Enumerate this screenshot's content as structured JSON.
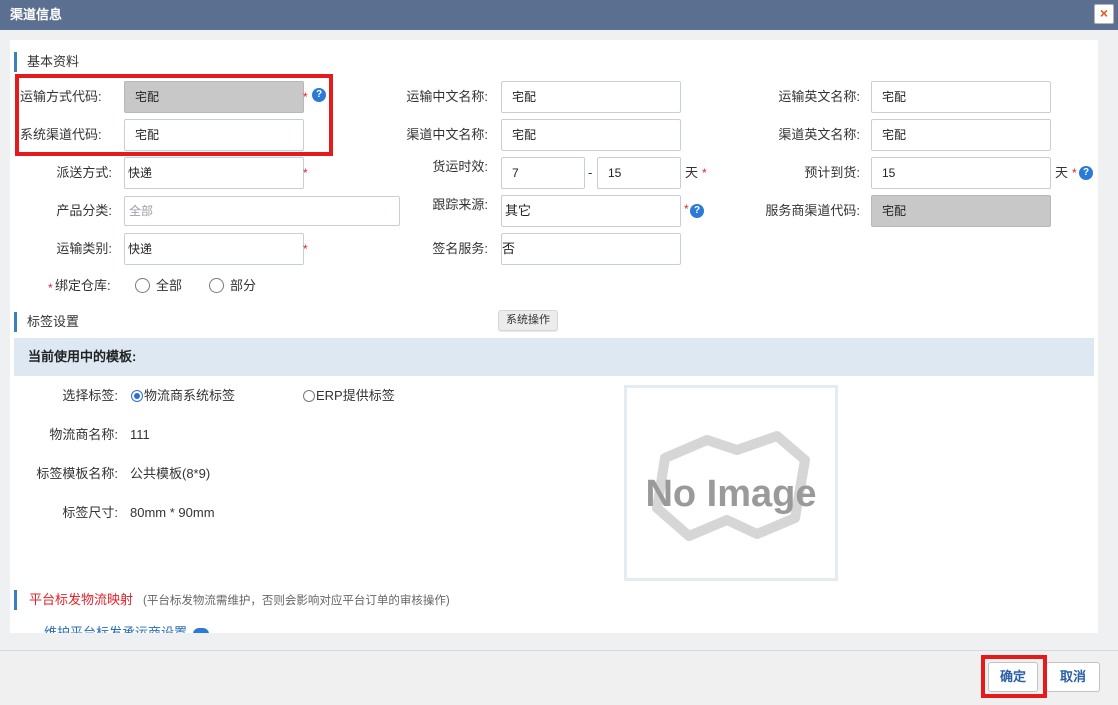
{
  "dialog": {
    "title": "渠道信息",
    "close": "×"
  },
  "basic": {
    "heading": "基本资料",
    "transport_code": {
      "label": "运输方式代码:",
      "value": "宅配"
    },
    "transport_cn": {
      "label": "运输中文名称:",
      "value": "宅配"
    },
    "transport_en": {
      "label": "运输英文名称:",
      "value": "宅配"
    },
    "channel_code": {
      "label": "系统渠道代码:",
      "value": "宅配"
    },
    "channel_cn": {
      "label": "渠道中文名称:",
      "value": "宅配"
    },
    "channel_en": {
      "label": "渠道英文名称:",
      "value": "宅配"
    },
    "delivery": {
      "label": "派送方式:",
      "value": "快递"
    },
    "timeliness": {
      "label": "货运时效:",
      "min": "7",
      "sep": "-",
      "max": "15",
      "unit": "天"
    },
    "arrival": {
      "label": "预计到货:",
      "value": "15",
      "unit": "天"
    },
    "product_cat": {
      "label": "产品分类:",
      "placeholder": "全部"
    },
    "tracking": {
      "label": "跟踪来源:",
      "value": "其它"
    },
    "provider_code": {
      "label": "服务商渠道代码:",
      "value": "宅配"
    },
    "transport_type": {
      "label": "运输类别:",
      "value": "快递"
    },
    "signature": {
      "label": "签名服务:",
      "value": "否"
    },
    "warehouse": {
      "label": "绑定仓库:",
      "option_all": "全部",
      "option_part": "部分"
    },
    "required_mark": "*",
    "help_mark": "?"
  },
  "label_settings": {
    "heading": "标签设置",
    "sys_op_button": "系统操作",
    "current_template": "当前使用中的模板:",
    "select_label": "选择标签:",
    "option_logistics": "物流商系统标签",
    "option_erp": "ERP提供标签",
    "provider_name_label": "物流商名称:",
    "provider_name": "111",
    "template_name_label": "标签模板名称:",
    "template_name": "公共模板(8*9)",
    "size_label": "标签尺寸:",
    "size": "80mm * 90mm",
    "no_image": "No Image"
  },
  "platform": {
    "heading": "平台标发物流映射",
    "note": "(平台标发物流需维护，否则会影响对应平台订单的审核操作)",
    "link": "维护平台标发承运商设置"
  },
  "footer": {
    "confirm": "确定",
    "cancel": "取消"
  },
  "colors": {
    "title_bar": "#5b6f91",
    "accent": "#3a7fc1",
    "highlight": "#e51b1b",
    "required": "#e5202a"
  }
}
